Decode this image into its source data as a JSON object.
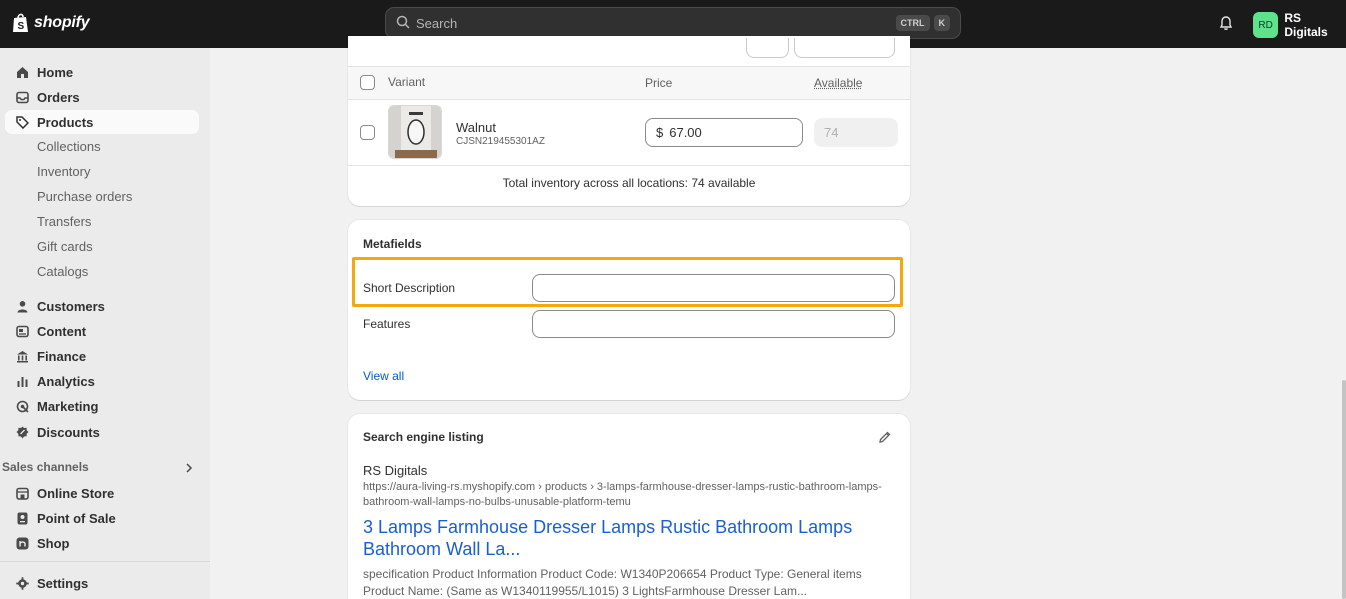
{
  "topbar": {
    "brand": "shopify",
    "search_placeholder": "Search",
    "shortcut_1": "CTRL",
    "shortcut_2": "K",
    "store_initials": "RD",
    "store_name": "RS Digitals"
  },
  "sidebar": {
    "items": [
      {
        "label": "Home",
        "icon": "home-icon"
      },
      {
        "label": "Orders",
        "icon": "inbox-icon"
      },
      {
        "label": "Products",
        "icon": "tag-icon"
      },
      {
        "label": "Customers",
        "icon": "person-icon"
      },
      {
        "label": "Content",
        "icon": "content-icon"
      },
      {
        "label": "Finance",
        "icon": "bank-icon"
      },
      {
        "label": "Analytics",
        "icon": "bar-chart-icon"
      },
      {
        "label": "Marketing",
        "icon": "target-icon"
      },
      {
        "label": "Discounts",
        "icon": "discount-icon"
      }
    ],
    "product_subitems": [
      "Collections",
      "Inventory",
      "Purchase orders",
      "Transfers",
      "Gift cards",
      "Catalogs"
    ],
    "sales_channels_label": "Sales channels",
    "channels": [
      {
        "label": "Online Store",
        "icon": "store-icon"
      },
      {
        "label": "Point of Sale",
        "icon": "pos-icon"
      },
      {
        "label": "Shop",
        "icon": "shop-icon"
      }
    ],
    "settings_label": "Settings"
  },
  "variants": {
    "columns": {
      "variant": "Variant",
      "price": "Price",
      "available": "Available"
    },
    "rows": [
      {
        "name": "Walnut",
        "sku": "CJSN219455301AZ",
        "currency": "$",
        "price": "67.00",
        "available": "74"
      }
    ],
    "total_text": "Total inventory across all locations: 74 available"
  },
  "metafields": {
    "title": "Metafields",
    "fields": [
      {
        "label": "Short Description",
        "value": ""
      },
      {
        "label": "Features",
        "value": ""
      }
    ],
    "view_all": "View all"
  },
  "seo": {
    "title": "Search engine listing",
    "store": "RS Digitals",
    "url": "https://aura-living-rs.myshopify.com › products › 3-lamps-farmhouse-dresser-lamps-rustic-bathroom-lamps-bathroom-wall-lamps-no-bulbs-unusable-platform-temu",
    "page_title": "3 Lamps Farmhouse Dresser Lamps Rustic Bathroom Lamps Bathroom Wall La...",
    "description": "specification Product Information Product Code: W1340P206654 Product Type: General items Product Name: (Same as W1340119955/L1015) 3 LightsFarmhouse Dresser Lam..."
  },
  "colors": {
    "topbar": "#1a1a1a",
    "highlight": "#f5a70e",
    "link": "#005bd3",
    "avatar": "#5ce38b"
  }
}
